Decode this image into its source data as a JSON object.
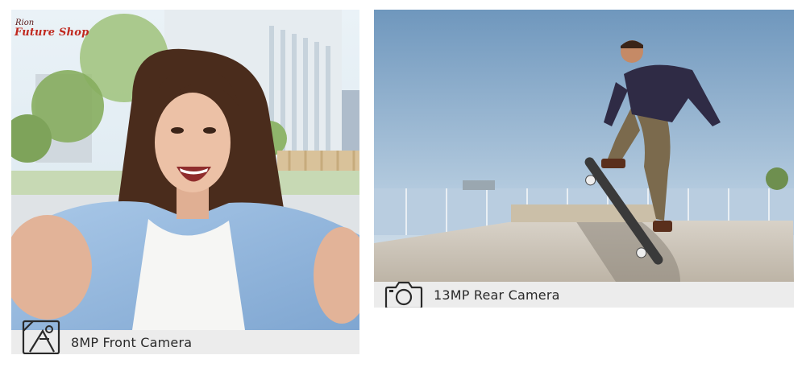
{
  "brand": {
    "small_text": "Rion",
    "main_text": "Future Shop",
    "color": "#c0281e"
  },
  "front_camera": {
    "label": "8MP Front Camera",
    "icon": "selfie-camera-icon"
  },
  "rear_camera": {
    "label": "13MP Rear Camera",
    "icon": "camera-icon"
  },
  "colors": {
    "caption_bar": "#ececec",
    "caption_text": "#2a2a2a"
  }
}
